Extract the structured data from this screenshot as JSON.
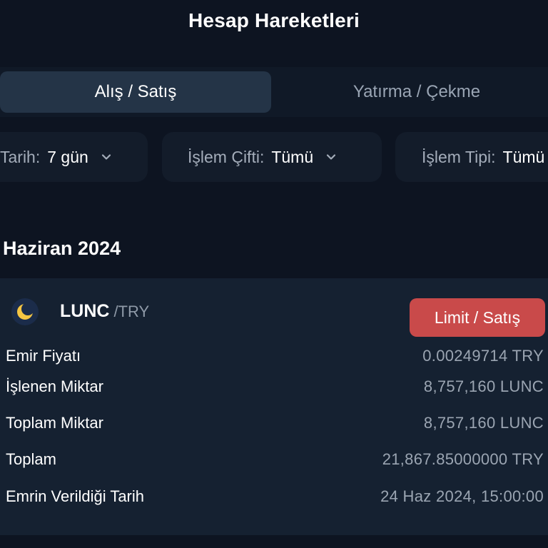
{
  "header": {
    "title": "Hesap Hareketleri"
  },
  "tabs": [
    {
      "label": "Alış / Satış",
      "active": true
    },
    {
      "label": "Yatırma / Çekme",
      "active": false
    }
  ],
  "filters": {
    "date": {
      "label": "Tarih:",
      "value": "7 gün"
    },
    "pair": {
      "label": "İşlem Çifti:",
      "value": "Tümü"
    },
    "type": {
      "label": "İşlem Tipi:",
      "value": "Tümü"
    }
  },
  "month_heading": "Haziran 2024",
  "order": {
    "base": "LUNC",
    "quote": "/TRY",
    "badge": "Limit / Satış",
    "rows": [
      {
        "label": "Emir Fiyatı",
        "value": "0.00249714 TRY"
      },
      {
        "label": "İşlenen Miktar",
        "value": "8,757,160 LUNC"
      },
      {
        "label": "Toplam Miktar",
        "value": "8,757,160 LUNC"
      },
      {
        "label": "Toplam",
        "value": "21,867.85000000 TRY"
      },
      {
        "label": "Emrin Verildiği Tarih",
        "value": "24 Haz 2024, 15:00:00"
      }
    ]
  },
  "colors": {
    "background": "#0d1421",
    "card": "#152131",
    "active_tab": "#243447",
    "sell_badge": "#c94a4a",
    "coin_icon": "#f5c542"
  },
  "icons": {
    "coin": "terra-classic-coin-icon",
    "dropdown": "chevron-down-icon"
  }
}
